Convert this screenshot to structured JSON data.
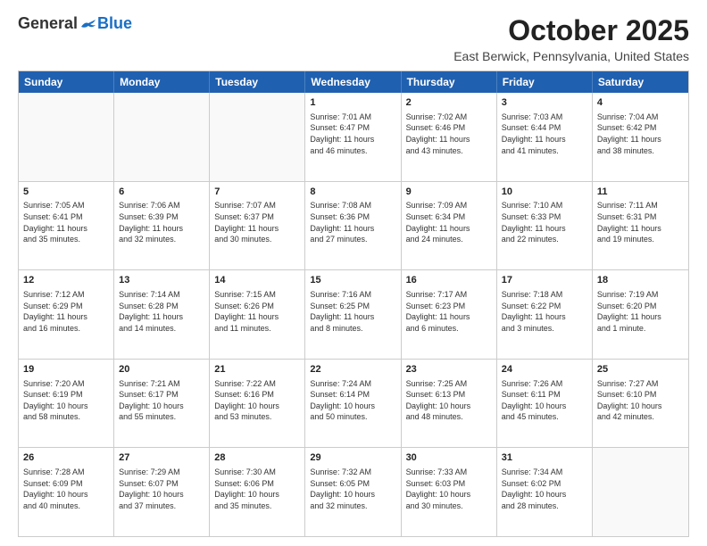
{
  "header": {
    "logo_general": "General",
    "logo_blue": "Blue",
    "month_title": "October 2025",
    "location": "East Berwick, Pennsylvania, United States"
  },
  "weekdays": [
    "Sunday",
    "Monday",
    "Tuesday",
    "Wednesday",
    "Thursday",
    "Friday",
    "Saturday"
  ],
  "rows": [
    [
      {
        "day": "",
        "info": ""
      },
      {
        "day": "",
        "info": ""
      },
      {
        "day": "",
        "info": ""
      },
      {
        "day": "1",
        "info": "Sunrise: 7:01 AM\nSunset: 6:47 PM\nDaylight: 11 hours\nand 46 minutes."
      },
      {
        "day": "2",
        "info": "Sunrise: 7:02 AM\nSunset: 6:46 PM\nDaylight: 11 hours\nand 43 minutes."
      },
      {
        "day": "3",
        "info": "Sunrise: 7:03 AM\nSunset: 6:44 PM\nDaylight: 11 hours\nand 41 minutes."
      },
      {
        "day": "4",
        "info": "Sunrise: 7:04 AM\nSunset: 6:42 PM\nDaylight: 11 hours\nand 38 minutes."
      }
    ],
    [
      {
        "day": "5",
        "info": "Sunrise: 7:05 AM\nSunset: 6:41 PM\nDaylight: 11 hours\nand 35 minutes."
      },
      {
        "day": "6",
        "info": "Sunrise: 7:06 AM\nSunset: 6:39 PM\nDaylight: 11 hours\nand 32 minutes."
      },
      {
        "day": "7",
        "info": "Sunrise: 7:07 AM\nSunset: 6:37 PM\nDaylight: 11 hours\nand 30 minutes."
      },
      {
        "day": "8",
        "info": "Sunrise: 7:08 AM\nSunset: 6:36 PM\nDaylight: 11 hours\nand 27 minutes."
      },
      {
        "day": "9",
        "info": "Sunrise: 7:09 AM\nSunset: 6:34 PM\nDaylight: 11 hours\nand 24 minutes."
      },
      {
        "day": "10",
        "info": "Sunrise: 7:10 AM\nSunset: 6:33 PM\nDaylight: 11 hours\nand 22 minutes."
      },
      {
        "day": "11",
        "info": "Sunrise: 7:11 AM\nSunset: 6:31 PM\nDaylight: 11 hours\nand 19 minutes."
      }
    ],
    [
      {
        "day": "12",
        "info": "Sunrise: 7:12 AM\nSunset: 6:29 PM\nDaylight: 11 hours\nand 16 minutes."
      },
      {
        "day": "13",
        "info": "Sunrise: 7:14 AM\nSunset: 6:28 PM\nDaylight: 11 hours\nand 14 minutes."
      },
      {
        "day": "14",
        "info": "Sunrise: 7:15 AM\nSunset: 6:26 PM\nDaylight: 11 hours\nand 11 minutes."
      },
      {
        "day": "15",
        "info": "Sunrise: 7:16 AM\nSunset: 6:25 PM\nDaylight: 11 hours\nand 8 minutes."
      },
      {
        "day": "16",
        "info": "Sunrise: 7:17 AM\nSunset: 6:23 PM\nDaylight: 11 hours\nand 6 minutes."
      },
      {
        "day": "17",
        "info": "Sunrise: 7:18 AM\nSunset: 6:22 PM\nDaylight: 11 hours\nand 3 minutes."
      },
      {
        "day": "18",
        "info": "Sunrise: 7:19 AM\nSunset: 6:20 PM\nDaylight: 11 hours\nand 1 minute."
      }
    ],
    [
      {
        "day": "19",
        "info": "Sunrise: 7:20 AM\nSunset: 6:19 PM\nDaylight: 10 hours\nand 58 minutes."
      },
      {
        "day": "20",
        "info": "Sunrise: 7:21 AM\nSunset: 6:17 PM\nDaylight: 10 hours\nand 55 minutes."
      },
      {
        "day": "21",
        "info": "Sunrise: 7:22 AM\nSunset: 6:16 PM\nDaylight: 10 hours\nand 53 minutes."
      },
      {
        "day": "22",
        "info": "Sunrise: 7:24 AM\nSunset: 6:14 PM\nDaylight: 10 hours\nand 50 minutes."
      },
      {
        "day": "23",
        "info": "Sunrise: 7:25 AM\nSunset: 6:13 PM\nDaylight: 10 hours\nand 48 minutes."
      },
      {
        "day": "24",
        "info": "Sunrise: 7:26 AM\nSunset: 6:11 PM\nDaylight: 10 hours\nand 45 minutes."
      },
      {
        "day": "25",
        "info": "Sunrise: 7:27 AM\nSunset: 6:10 PM\nDaylight: 10 hours\nand 42 minutes."
      }
    ],
    [
      {
        "day": "26",
        "info": "Sunrise: 7:28 AM\nSunset: 6:09 PM\nDaylight: 10 hours\nand 40 minutes."
      },
      {
        "day": "27",
        "info": "Sunrise: 7:29 AM\nSunset: 6:07 PM\nDaylight: 10 hours\nand 37 minutes."
      },
      {
        "day": "28",
        "info": "Sunrise: 7:30 AM\nSunset: 6:06 PM\nDaylight: 10 hours\nand 35 minutes."
      },
      {
        "day": "29",
        "info": "Sunrise: 7:32 AM\nSunset: 6:05 PM\nDaylight: 10 hours\nand 32 minutes."
      },
      {
        "day": "30",
        "info": "Sunrise: 7:33 AM\nSunset: 6:03 PM\nDaylight: 10 hours\nand 30 minutes."
      },
      {
        "day": "31",
        "info": "Sunrise: 7:34 AM\nSunset: 6:02 PM\nDaylight: 10 hours\nand 28 minutes."
      },
      {
        "day": "",
        "info": ""
      }
    ]
  ]
}
